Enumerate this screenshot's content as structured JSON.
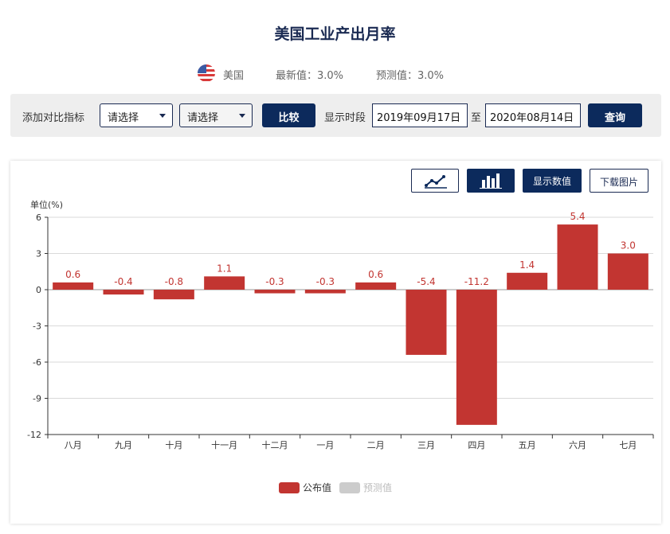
{
  "page": {
    "title": "美国工业产出月率"
  },
  "info": {
    "country": "美国",
    "latest": "最新值：3.0%",
    "forecast": "预测值：3.0%"
  },
  "filter": {
    "compare_label": "添加对比指标",
    "select1": "请选择",
    "select2": "请选择",
    "compare_button": "比较",
    "period_label": "显示时段",
    "start_date": "2019年09月17日",
    "to_label": "至",
    "end_date": "2020年08月14日",
    "query_button": "查询"
  },
  "toolbar": {
    "line_icon": "line-chart-icon",
    "bar_icon": "bar-chart-icon",
    "show_values": "显示数值",
    "download": "下载图片"
  },
  "colors": {
    "bar": "#c23531",
    "forecast": "#cccccc",
    "navy": "#0c2a5c"
  },
  "chart_data": {
    "type": "bar",
    "unit_label": "单位(%)",
    "categories": [
      "八月",
      "九月",
      "十月",
      "十一月",
      "十二月",
      "一月",
      "二月",
      "三月",
      "四月",
      "五月",
      "六月",
      "七月"
    ],
    "series": [
      {
        "name": "公布值",
        "values": [
          0.6,
          -0.4,
          -0.8,
          1.1,
          -0.3,
          -0.3,
          0.6,
          -5.4,
          -11.2,
          1.4,
          5.4,
          3.0
        ]
      },
      {
        "name": "预测值",
        "values": []
      }
    ],
    "data_labels": [
      "0.6",
      "-0.4",
      "-0.8",
      "1.1",
      "-0.3",
      "-0.3",
      "0.6",
      "-5.4",
      "-11.2",
      "1.4",
      "5.4",
      "3.0"
    ],
    "y_ticks": [
      "6",
      "3",
      "0",
      "-3",
      "-6",
      "-9",
      "-12"
    ],
    "ylim": [
      -12,
      6
    ],
    "grid": true,
    "legend_position": "bottom-center"
  }
}
